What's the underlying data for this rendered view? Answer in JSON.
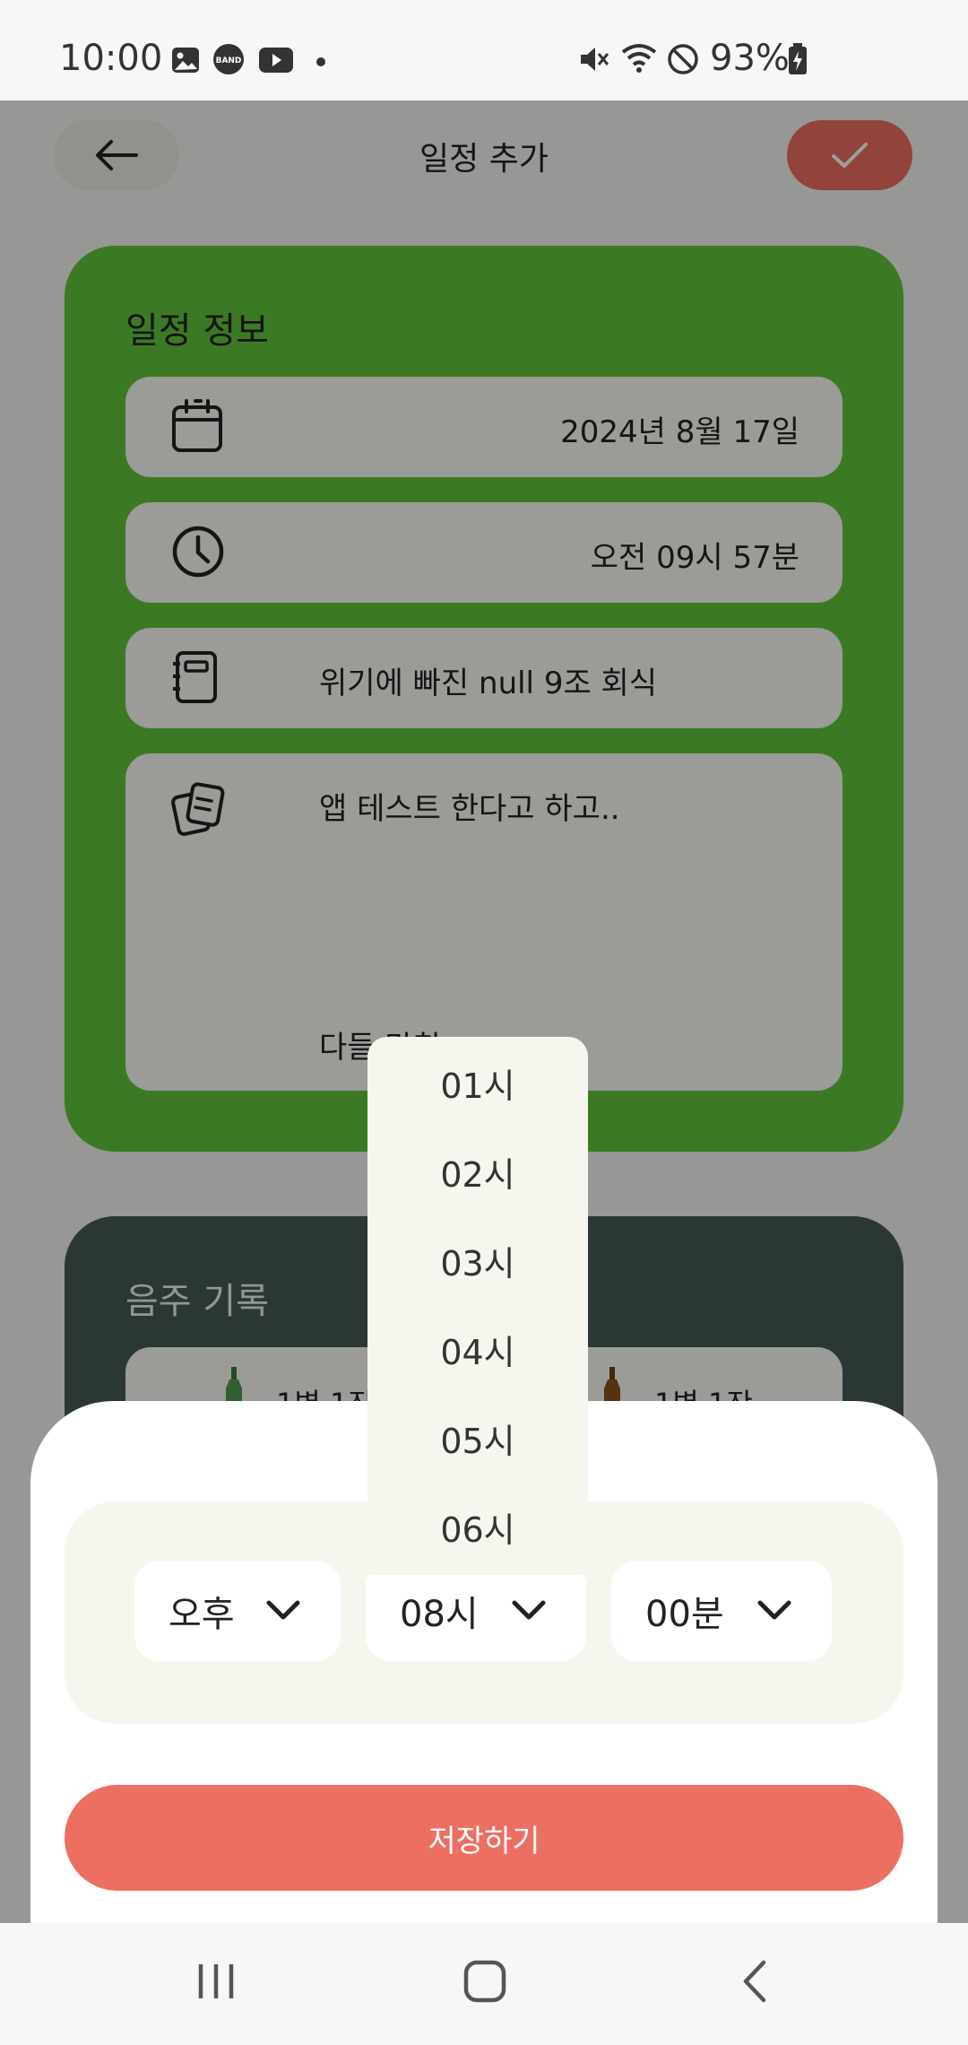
{
  "status_bar": {
    "time": "10:00",
    "battery": "93%",
    "icons": [
      "gallery-icon",
      "band-icon",
      "youtube-icon",
      "dot-icon",
      "mute-icon",
      "wifi-icon",
      "do-not-disturb-icon",
      "battery-charging-icon"
    ]
  },
  "header": {
    "title": "일정 추가",
    "back_icon": "arrow-left-icon",
    "confirm_icon": "check-icon"
  },
  "schedule_info": {
    "title": "일정 정보",
    "date": "2024년 8월 17일",
    "time": "오전 09시 57분",
    "name": "위기에 빠진 null 9조 회식",
    "memo_line1": "앱 테스트 한다고 하고..",
    "memo_line2": "다들 망침"
  },
  "drink_record": {
    "title": "음주 기록",
    "items": [
      {
        "label": "1병 1잔",
        "icon": "soju-bottle-icon"
      },
      {
        "label": "1병 1잔",
        "icon": "beer-bottle-icon"
      }
    ]
  },
  "time_picker": {
    "ampm": "오후",
    "hour": "08시",
    "minute": "00분",
    "hour_options": [
      "01시",
      "02시",
      "03시",
      "04시",
      "05시",
      "06시"
    ]
  },
  "save_button": "저장하기",
  "colors": {
    "accent": "#ec6f62",
    "info_card": "#62c33a",
    "drink_card": "#455a56",
    "panel": "#f6f6ee"
  }
}
